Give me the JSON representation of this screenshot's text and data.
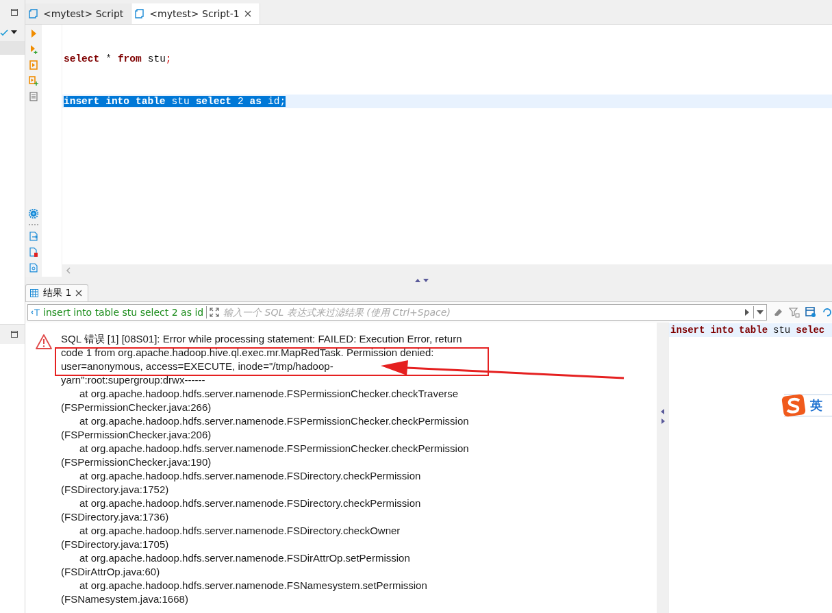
{
  "tabs": [
    {
      "label": "<mytest> Script",
      "selected": false
    },
    {
      "label": "<mytest> Script-1",
      "selected": true
    }
  ],
  "editor": {
    "lines": [
      {
        "selected": false,
        "tokens": [
          {
            "text": "select",
            "kind": "keyword"
          },
          {
            "text": "*",
            "kind": "text"
          },
          {
            "text": "from",
            "kind": "keyword"
          },
          {
            "text": "stu",
            "kind": "text"
          },
          {
            "text": ";",
            "kind": "punct"
          }
        ]
      },
      {
        "selected": true,
        "tokens": [
          {
            "text": "insert",
            "kind": "keyword"
          },
          {
            "text": "into",
            "kind": "keyword"
          },
          {
            "text": "table",
            "kind": "keyword"
          },
          {
            "text": "stu",
            "kind": "text"
          },
          {
            "text": "select",
            "kind": "keyword"
          },
          {
            "text": "2",
            "kind": "text"
          },
          {
            "text": "as",
            "kind": "keyword"
          },
          {
            "text": "id",
            "kind": "text"
          },
          {
            "text": ";",
            "kind": "punct"
          }
        ]
      }
    ]
  },
  "results": {
    "tabs": [
      {
        "label": "结果 1",
        "selected": true
      }
    ],
    "filter": {
      "query_label": "insert into table stu select 2 as id",
      "placeholder": "输入一个 SQL 表达式来过滤结果 (使用 Ctrl+Space)"
    },
    "error_lines": [
      {
        "kind": "message",
        "text": "SQL 错误 [1] [08S01]: Error while processing statement: FAILED: Execution Error, return"
      },
      {
        "kind": "message",
        "text": "code 1 from org.apache.hadoop.hive.ql.exec.mr.MapRedTask. Permission denied:"
      },
      {
        "kind": "message",
        "text": "user=anonymous, access=EXECUTE, inode=\"/tmp/hadoop-"
      },
      {
        "kind": "message",
        "text": "yarn\":root:supergroup:drwx------"
      },
      {
        "kind": "frame",
        "text": "at org.apache.hadoop.hdfs.server.namenode.FSPermissionChecker.checkTraverse"
      },
      {
        "kind": "location",
        "text": "(FSPermissionChecker.java:266)"
      },
      {
        "kind": "frame",
        "text": "at org.apache.hadoop.hdfs.server.namenode.FSPermissionChecker.checkPermission"
      },
      {
        "kind": "location",
        "text": "(FSPermissionChecker.java:206)"
      },
      {
        "kind": "frame",
        "text": "at org.apache.hadoop.hdfs.server.namenode.FSPermissionChecker.checkPermission"
      },
      {
        "kind": "location",
        "text": "(FSPermissionChecker.java:190)"
      },
      {
        "kind": "frame",
        "text": "at org.apache.hadoop.hdfs.server.namenode.FSDirectory.checkPermission"
      },
      {
        "kind": "location",
        "text": "(FSDirectory.java:1752)"
      },
      {
        "kind": "frame",
        "text": "at org.apache.hadoop.hdfs.server.namenode.FSDirectory.checkPermission"
      },
      {
        "kind": "location",
        "text": "(FSDirectory.java:1736)"
      },
      {
        "kind": "frame",
        "text": "at org.apache.hadoop.hdfs.server.namenode.FSDirectory.checkOwner"
      },
      {
        "kind": "location",
        "text": "(FSDirectory.java:1705)"
      },
      {
        "kind": "frame",
        "text": "at org.apache.hadoop.hdfs.server.namenode.FSDirAttrOp.setPermission"
      },
      {
        "kind": "location",
        "text": "(FSDirAttrOp.java:60)"
      },
      {
        "kind": "frame",
        "text": "at org.apache.hadoop.hdfs.server.namenode.FSNamesystem.setPermission"
      },
      {
        "kind": "location",
        "text": "(FSNamesystem.java:1668)"
      }
    ],
    "query_tokens": [
      {
        "text": "insert",
        "kind": "keyword"
      },
      {
        "text": "into",
        "kind": "keyword"
      },
      {
        "text": "table",
        "kind": "keyword"
      },
      {
        "text": "stu",
        "kind": "text"
      },
      {
        "text": "selec",
        "kind": "keyword"
      }
    ]
  },
  "ime": {
    "label": "英"
  }
}
